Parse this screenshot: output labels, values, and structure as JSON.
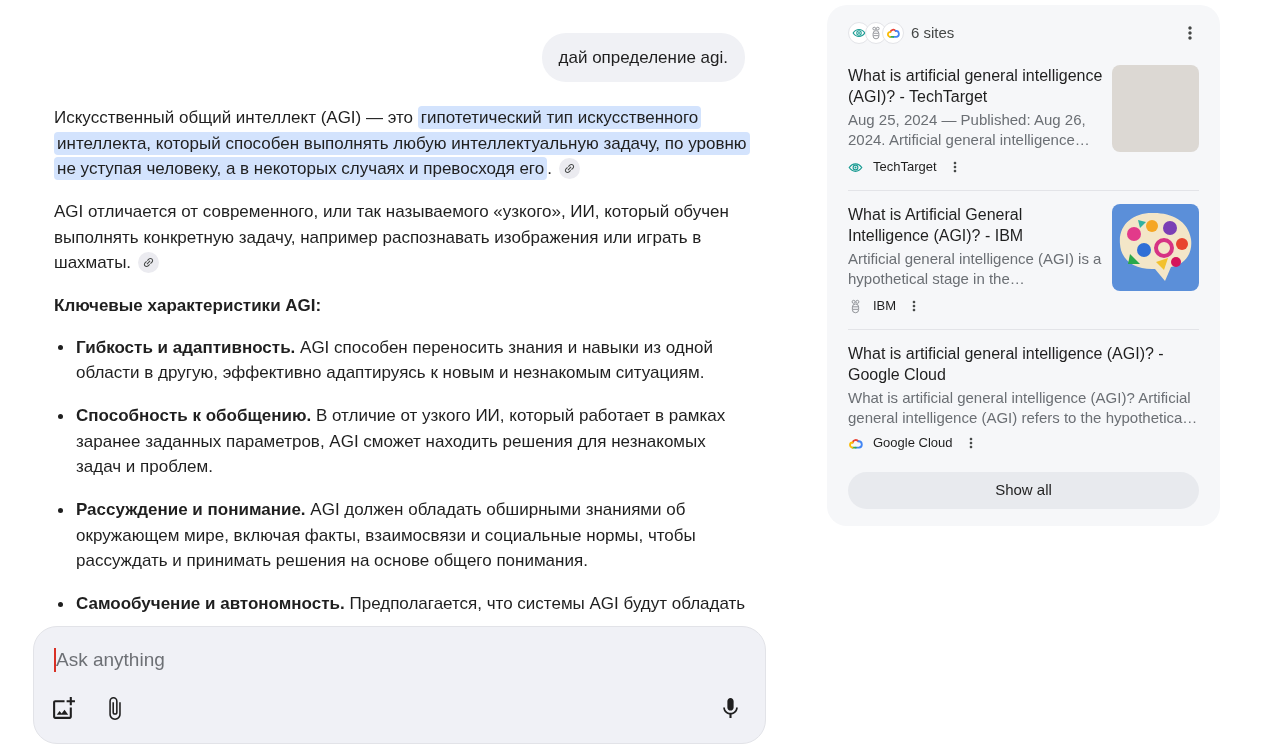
{
  "chat": {
    "user_message": "дай определение agi.",
    "response": [
      {
        "kind": "paragraph",
        "segments": [
          {
            "text": "Искусственный общий интеллект (AGI) — это ",
            "highlighted": false
          },
          {
            "text": "гипотетический тип искусственного интеллекта, который способен выполнять любую интеллектуальную задачу, по уровню не уступая человеку, а в некоторых случаях и превосходя его",
            "highlighted": true
          },
          {
            "text": ".",
            "highlighted": false
          }
        ],
        "citation": true
      },
      {
        "kind": "paragraph",
        "segments": [
          {
            "text": "AGI отличается от современного, или так называемого «узкого», ИИ, который обучен выполнять конкретную задачу, например распознавать изображения или играть в шахматы.",
            "highlighted": false
          }
        ],
        "citation": true
      },
      {
        "kind": "heading",
        "text": "Ключевые характеристики AGI:"
      },
      {
        "kind": "bullets",
        "items": [
          "**Гибкость и адаптивность.** AGI способен переносить знания и навыки из одной области в другую, эффективно адаптируясь к новым и незнакомым ситуациям.",
          "**Способность к обобщению.** В отличие от узкого ИИ, который работает в рамках заранее заданных параметров, AGI сможет находить решения для незнакомых задач и проблем.",
          "**Рассуждение и понимание.** AGI должен обладать обширными знаниями об окружающем мире, включая факты, взаимосвязи и социальные нормы, чтобы рассуждать и принимать решения на основе общего понимания.",
          "**Самообучение и автономность.** Предполагается, что системы AGI будут обладать"
        ]
      }
    ]
  },
  "composer": {
    "placeholder": "Ask anything"
  },
  "sources": {
    "summary": "6 sites",
    "results": [
      {
        "kind": "photo",
        "title": "What is artificial general intelligence (AGI)? - TechTarget",
        "snippet": "Aug 25, 2024 — Published: Aug 26, 2024. Artificial general intelligence…",
        "source": "TechTarget"
      },
      {
        "kind": "artwork",
        "title": "What is Artificial General Intelligence (AGI)? - IBM",
        "snippet": "Artificial general intelligence (AGI) is a hypothetical stage in the…",
        "source": "IBM"
      },
      {
        "kind": "text",
        "title": "What is artificial general intelligence (AGI)? - Google Cloud",
        "snippet": "What is artificial general intelligence (AGI)? Artificial general intelligence (AGI) refers to the hypothetica…",
        "source": "Google Cloud"
      }
    ],
    "show_all": "Show all"
  }
}
